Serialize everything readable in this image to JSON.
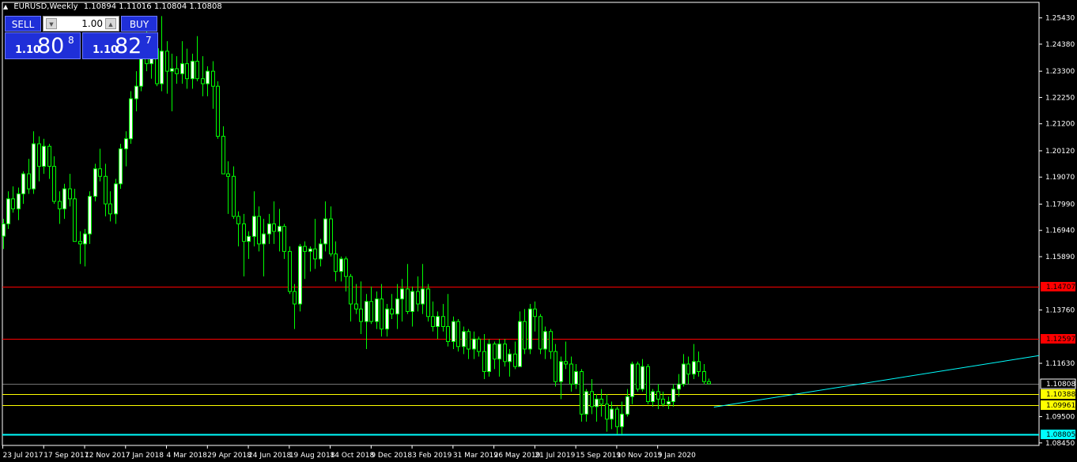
{
  "header": {
    "symbol": "EURUSD,Weekly",
    "ohlc": "1.10894 1.11016 1.10804 1.10808"
  },
  "trade_panel": {
    "sell_label": "SELL",
    "buy_label": "BUY",
    "lot_value": "1.00",
    "sell_price": {
      "prefix": "1.10",
      "big": "80",
      "sup": "8"
    },
    "buy_price": {
      "prefix": "1.10",
      "big": "82",
      "sup": "7"
    }
  },
  "colors": {
    "background": "#000000",
    "bull_candle": "#ffffff",
    "bear_candle": "#000000",
    "candle_wick": "#00ff00",
    "resistance_line": "#ff0000",
    "support_line": "#ffff00",
    "trend_line": "#00ffff",
    "bid_line": "#c0c0c0"
  },
  "chart_data": {
    "type": "candlestick",
    "symbol": "EURUSD",
    "timeframe": "Weekly",
    "y_ticks": [
      "1.25430",
      "1.24380",
      "1.23300",
      "1.22250",
      "1.21200",
      "1.20120",
      "1.19070",
      "1.17990",
      "1.16940",
      "1.15890",
      "1.13760",
      "1.11630",
      "1.09500",
      "1.08450"
    ],
    "x_ticks": [
      "23 Jul 2017",
      "17 Sep 2017",
      "12 Nov 2017",
      "7 Jan 2018",
      "4 Mar 2018",
      "29 Apr 2018",
      "24 Jun 2018",
      "19 Aug 2018",
      "14 Oct 2018",
      "9 Dec 2018",
      "3 Feb 2019",
      "31 Mar 2019",
      "26 May 2019",
      "21 Jul 2019",
      "15 Sep 2019",
      "10 Nov 2019",
      "5 Jan 2020"
    ],
    "ylim": [
      1.0835,
      1.2605
    ],
    "horizontal_lines": [
      {
        "price": 1.14707,
        "label": "1.14707",
        "color": "#ff0000"
      },
      {
        "price": 1.12597,
        "label": "1.12597",
        "color": "#ff0000"
      },
      {
        "price": 1.10388,
        "label": "1.10388",
        "color": "#ffff00"
      },
      {
        "price": 1.09961,
        "label": "1.09961",
        "color": "#ffff00"
      },
      {
        "price": 1.08805,
        "label": "1.08805",
        "color": "#00ffff"
      }
    ],
    "bid_line": {
      "price": 1.10808,
      "label": "1.10808"
    },
    "trend_line": {
      "from": {
        "week": 139,
        "price": 1.0988
      },
      "to": {
        "week": 189,
        "price": 1.115
      }
    },
    "candles": [
      [
        1.1671,
        1.174,
        1.162,
        1.172
      ],
      [
        1.172,
        1.185,
        1.17,
        1.182
      ],
      [
        1.182,
        1.187,
        1.1765,
        1.178
      ],
      [
        1.178,
        1.1865,
        1.1735,
        1.184
      ],
      [
        1.184,
        1.193,
        1.18,
        1.192
      ],
      [
        1.192,
        1.198,
        1.184,
        1.186
      ],
      [
        1.186,
        1.209,
        1.184,
        1.204
      ],
      [
        1.204,
        1.207,
        1.189,
        1.195
      ],
      [
        1.195,
        1.206,
        1.192,
        1.203
      ],
      [
        1.203,
        1.204,
        1.19,
        1.195
      ],
      [
        1.195,
        1.199,
        1.18,
        1.181
      ],
      [
        1.181,
        1.185,
        1.172,
        1.178
      ],
      [
        1.178,
        1.188,
        1.174,
        1.186
      ],
      [
        1.186,
        1.192,
        1.179,
        1.182
      ],
      [
        1.182,
        1.186,
        1.166,
        1.165
      ],
      [
        1.165,
        1.169,
        1.156,
        1.164
      ],
      [
        1.164,
        1.17,
        1.155,
        1.168
      ],
      [
        1.168,
        1.185,
        1.164,
        1.183
      ],
      [
        1.183,
        1.196,
        1.181,
        1.194
      ],
      [
        1.194,
        1.202,
        1.189,
        1.191
      ],
      [
        1.191,
        1.196,
        1.175,
        1.18
      ],
      [
        1.18,
        1.185,
        1.173,
        1.176
      ],
      [
        1.176,
        1.19,
        1.172,
        1.188
      ],
      [
        1.188,
        1.204,
        1.186,
        1.202
      ],
      [
        1.202,
        1.209,
        1.195,
        1.206
      ],
      [
        1.206,
        1.225,
        1.204,
        1.222
      ],
      [
        1.222,
        1.233,
        1.217,
        1.227
      ],
      [
        1.227,
        1.244,
        1.225,
        1.241
      ],
      [
        1.241,
        1.252,
        1.233,
        1.236
      ],
      [
        1.236,
        1.246,
        1.23,
        1.242
      ],
      [
        1.242,
        1.248,
        1.227,
        1.228
      ],
      [
        1.228,
        1.255,
        1.225,
        1.241
      ],
      [
        1.241,
        1.245,
        1.224,
        1.233
      ],
      [
        1.233,
        1.24,
        1.217,
        1.234
      ],
      [
        1.234,
        1.239,
        1.228,
        1.232
      ],
      [
        1.232,
        1.245,
        1.228,
        1.236
      ],
      [
        1.236,
        1.242,
        1.226,
        1.23
      ],
      [
        1.23,
        1.24,
        1.226,
        1.237
      ],
      [
        1.237,
        1.247,
        1.229,
        1.23
      ],
      [
        1.23,
        1.239,
        1.223,
        1.228
      ],
      [
        1.228,
        1.235,
        1.223,
        1.233
      ],
      [
        1.233,
        1.237,
        1.218,
        1.227
      ],
      [
        1.227,
        1.229,
        1.206,
        1.207
      ],
      [
        1.207,
        1.211,
        1.192,
        1.192
      ],
      [
        1.192,
        1.197,
        1.176,
        1.191
      ],
      [
        1.191,
        1.195,
        1.174,
        1.175
      ],
      [
        1.175,
        1.177,
        1.163,
        1.172
      ],
      [
        1.172,
        1.176,
        1.151,
        1.165
      ],
      [
        1.165,
        1.169,
        1.158,
        1.167
      ],
      [
        1.167,
        1.185,
        1.163,
        1.175
      ],
      [
        1.175,
        1.179,
        1.161,
        1.164
      ],
      [
        1.164,
        1.174,
        1.151,
        1.168
      ],
      [
        1.168,
        1.176,
        1.164,
        1.172
      ],
      [
        1.172,
        1.181,
        1.164,
        1.169
      ],
      [
        1.169,
        1.178,
        1.161,
        1.171
      ],
      [
        1.171,
        1.172,
        1.158,
        1.161
      ],
      [
        1.161,
        1.163,
        1.144,
        1.145
      ],
      [
        1.145,
        1.148,
        1.13,
        1.14
      ],
      [
        1.14,
        1.164,
        1.137,
        1.163
      ],
      [
        1.163,
        1.165,
        1.15,
        1.161
      ],
      [
        1.161,
        1.163,
        1.153,
        1.162
      ],
      [
        1.162,
        1.174,
        1.154,
        1.158
      ],
      [
        1.158,
        1.166,
        1.155,
        1.164
      ],
      [
        1.164,
        1.181,
        1.161,
        1.174
      ],
      [
        1.174,
        1.179,
        1.159,
        1.16
      ],
      [
        1.16,
        1.165,
        1.149,
        1.153
      ],
      [
        1.153,
        1.159,
        1.149,
        1.158
      ],
      [
        1.158,
        1.159,
        1.145,
        1.151
      ],
      [
        1.151,
        1.152,
        1.133,
        1.14
      ],
      [
        1.14,
        1.148,
        1.136,
        1.138
      ],
      [
        1.138,
        1.149,
        1.128,
        1.133
      ],
      [
        1.133,
        1.144,
        1.122,
        1.141
      ],
      [
        1.141,
        1.147,
        1.132,
        1.133
      ],
      [
        1.133,
        1.145,
        1.13,
        1.142
      ],
      [
        1.142,
        1.148,
        1.127,
        1.13
      ],
      [
        1.13,
        1.14,
        1.127,
        1.138
      ],
      [
        1.138,
        1.144,
        1.134,
        1.136
      ],
      [
        1.136,
        1.148,
        1.13,
        1.142
      ],
      [
        1.142,
        1.15,
        1.133,
        1.146
      ],
      [
        1.146,
        1.156,
        1.136,
        1.137
      ],
      [
        1.137,
        1.147,
        1.131,
        1.145
      ],
      [
        1.145,
        1.151,
        1.137,
        1.14
      ],
      [
        1.14,
        1.156,
        1.136,
        1.146
      ],
      [
        1.146,
        1.148,
        1.133,
        1.135
      ],
      [
        1.135,
        1.141,
        1.129,
        1.131
      ],
      [
        1.131,
        1.137,
        1.126,
        1.135
      ],
      [
        1.135,
        1.14,
        1.129,
        1.131
      ],
      [
        1.131,
        1.144,
        1.123,
        1.125
      ],
      [
        1.125,
        1.135,
        1.122,
        1.133
      ],
      [
        1.133,
        1.134,
        1.121,
        1.123
      ],
      [
        1.123,
        1.131,
        1.12,
        1.129
      ],
      [
        1.129,
        1.13,
        1.118,
        1.122
      ],
      [
        1.122,
        1.129,
        1.118,
        1.126
      ],
      [
        1.126,
        1.127,
        1.119,
        1.121
      ],
      [
        1.121,
        1.128,
        1.11,
        1.113
      ],
      [
        1.113,
        1.126,
        1.111,
        1.124
      ],
      [
        1.124,
        1.125,
        1.114,
        1.118
      ],
      [
        1.118,
        1.126,
        1.111,
        1.124
      ],
      [
        1.124,
        1.126,
        1.115,
        1.117
      ],
      [
        1.117,
        1.122,
        1.111,
        1.12
      ],
      [
        1.12,
        1.125,
        1.114,
        1.115
      ],
      [
        1.115,
        1.137,
        1.115,
        1.133
      ],
      [
        1.133,
        1.138,
        1.12,
        1.122
      ],
      [
        1.122,
        1.14,
        1.12,
        1.138
      ],
      [
        1.138,
        1.141,
        1.129,
        1.135
      ],
      [
        1.135,
        1.136,
        1.12,
        1.122
      ],
      [
        1.122,
        1.131,
        1.118,
        1.129
      ],
      [
        1.129,
        1.13,
        1.118,
        1.121
      ],
      [
        1.121,
        1.124,
        1.107,
        1.109
      ],
      [
        1.109,
        1.119,
        1.102,
        1.117
      ],
      [
        1.117,
        1.125,
        1.114,
        1.116
      ],
      [
        1.116,
        1.119,
        1.105,
        1.108
      ],
      [
        1.108,
        1.116,
        1.106,
        1.113
      ],
      [
        1.113,
        1.114,
        1.093,
        1.096
      ],
      [
        1.096,
        1.106,
        1.093,
        1.105
      ],
      [
        1.105,
        1.11,
        1.096,
        1.099
      ],
      [
        1.099,
        1.104,
        1.093,
        1.102
      ],
      [
        1.102,
        1.106,
        1.095,
        1.1
      ],
      [
        1.1,
        1.104,
        1.089,
        1.094
      ],
      [
        1.094,
        1.101,
        1.09,
        1.098
      ],
      [
        1.098,
        1.099,
        1.088,
        1.091
      ],
      [
        1.091,
        1.101,
        1.088,
        1.096
      ],
      [
        1.096,
        1.106,
        1.095,
        1.103
      ],
      [
        1.103,
        1.117,
        1.1,
        1.116
      ],
      [
        1.116,
        1.117,
        1.105,
        1.106
      ],
      [
        1.106,
        1.118,
        1.105,
        1.115
      ],
      [
        1.115,
        1.116,
        1.1,
        1.101
      ],
      [
        1.101,
        1.106,
        1.099,
        1.105
      ],
      [
        1.105,
        1.108,
        1.098,
        1.102
      ],
      [
        1.102,
        1.105,
        1.099,
        1.1
      ],
      [
        1.1,
        1.103,
        1.098,
        1.101
      ],
      [
        1.101,
        1.108,
        1.099,
        1.106
      ],
      [
        1.106,
        1.112,
        1.103,
        1.108
      ],
      [
        1.108,
        1.12,
        1.107,
        1.116
      ],
      [
        1.116,
        1.119,
        1.108,
        1.112
      ],
      [
        1.112,
        1.124,
        1.11,
        1.117
      ],
      [
        1.117,
        1.121,
        1.111,
        1.113
      ],
      [
        1.113,
        1.116,
        1.108,
        1.109
      ],
      [
        1.109,
        1.1102,
        1.108,
        1.1081
      ]
    ]
  }
}
